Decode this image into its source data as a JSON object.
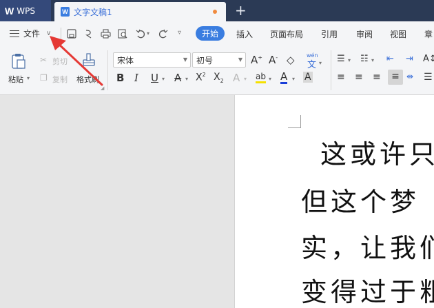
{
  "app": {
    "name": "WPS"
  },
  "tabs": {
    "doc_title": "文字文稿1",
    "new_tab": "+"
  },
  "menu": {
    "file_label": "文件",
    "items": [
      "开始",
      "插入",
      "页面布局",
      "引用",
      "审阅",
      "视图",
      "章"
    ]
  },
  "ribbon": {
    "paste": "粘贴",
    "cut": "剪切",
    "copy": "复制",
    "format_painter": "格式刷",
    "font_name": "宋体",
    "font_size": "初号",
    "phonetic": "wén"
  },
  "document": {
    "lines": [
      "这或许只",
      "但这个梦",
      "实，让我们",
      "变得过于粗"
    ]
  },
  "colors": {
    "title_bar": "#2b3a55",
    "accent": "#3a7de0",
    "annotation_arrow": "#e53935",
    "unsaved_dot": "#f08a3e"
  }
}
